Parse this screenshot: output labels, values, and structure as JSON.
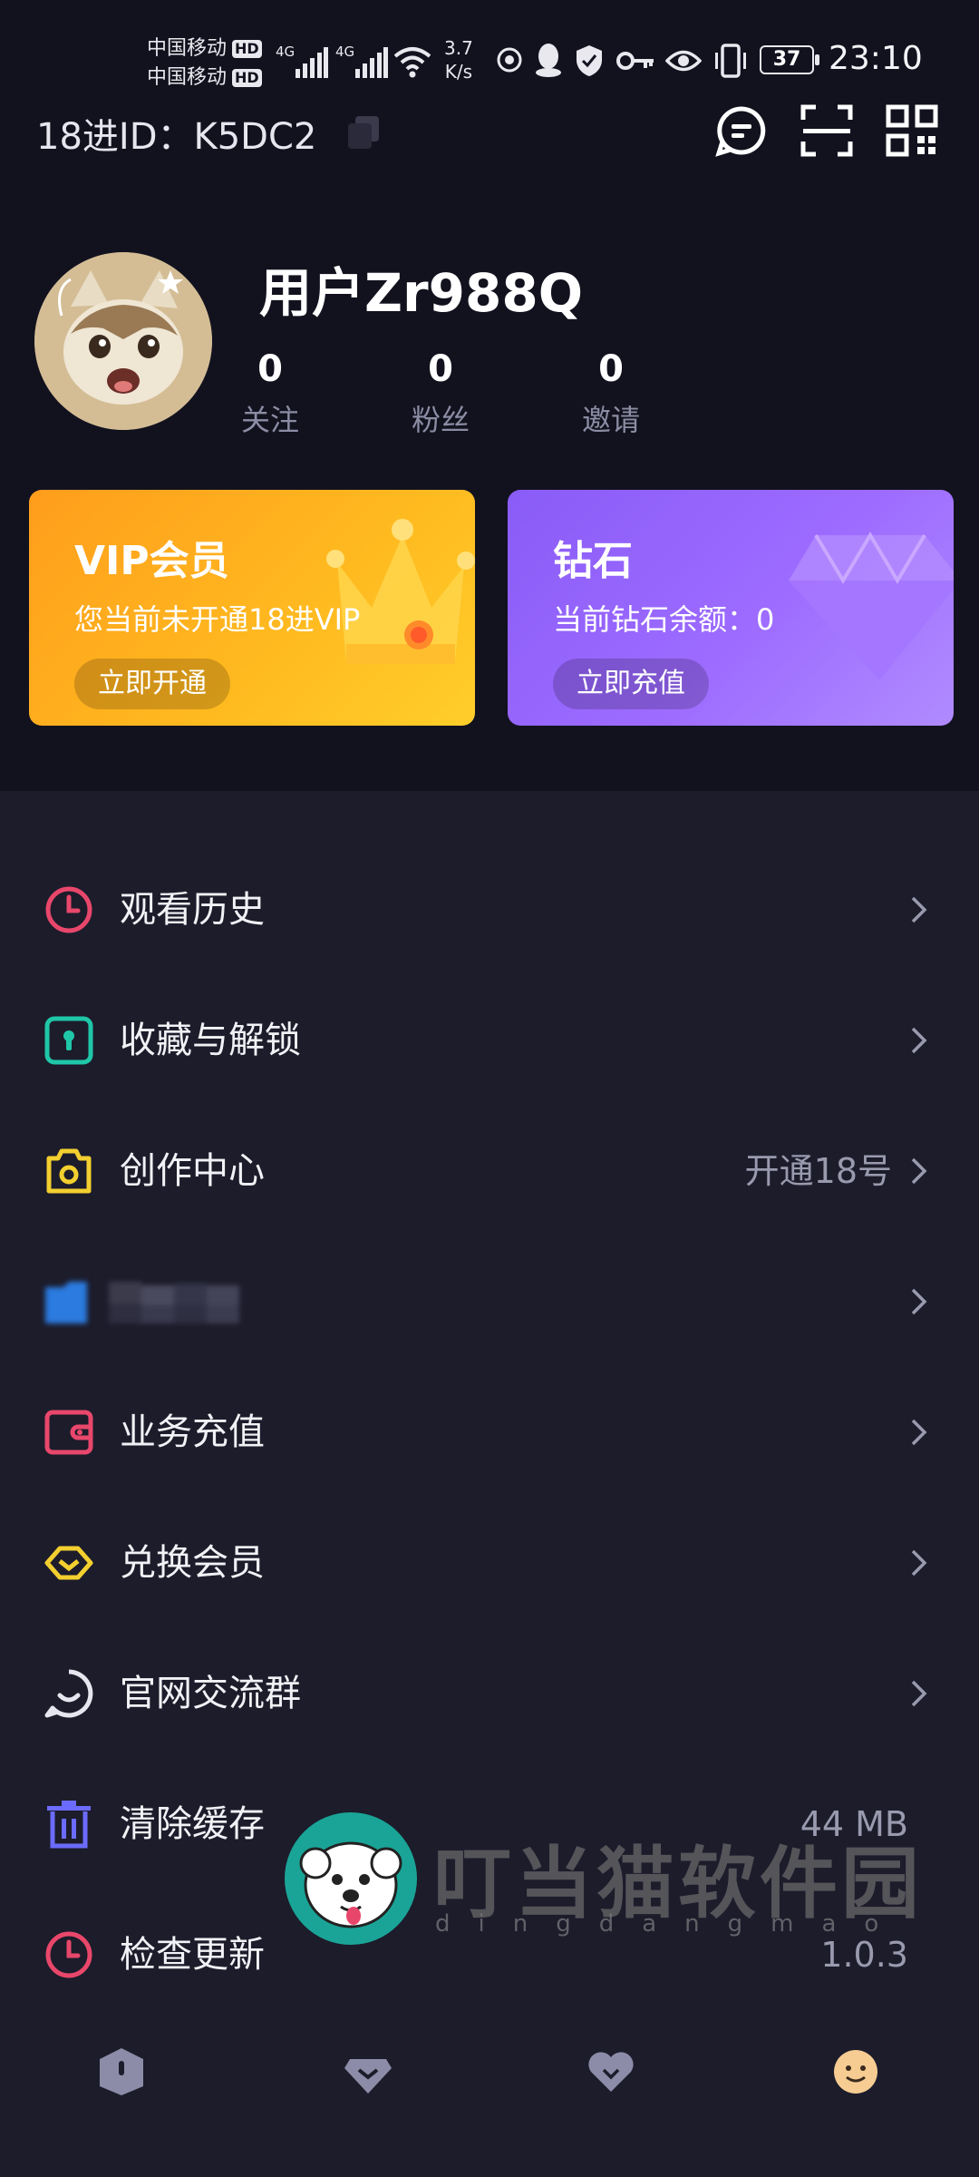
{
  "status_bar": {
    "carrier_1": "中国移动",
    "carrier_2": "中国移动",
    "hd_1": "HD",
    "hd_2": "HD",
    "sig_1": "4G",
    "sig_2": "4G",
    "net_speed_value": "3.7",
    "net_speed_unit": "K/s",
    "battery": "37",
    "time": "23:10",
    "icons": [
      "signal-icon",
      "wifi-icon",
      "qq-icon",
      "shield-icon",
      "key-icon",
      "eye-icon",
      "vibrate-icon",
      "battery-icon"
    ]
  },
  "header": {
    "user_id_text": "18进ID：K5DC2",
    "actions": [
      "message-icon",
      "scan-icon",
      "qrcode-icon"
    ]
  },
  "profile": {
    "username": "用户Zr988Q",
    "stats": [
      {
        "value": "0",
        "label": "关注"
      },
      {
        "value": "0",
        "label": "粉丝"
      },
      {
        "value": "0",
        "label": "邀请"
      }
    ]
  },
  "cards": {
    "vip": {
      "title": "VIP会员",
      "subtitle": "您当前未开通18进VIP",
      "button": "立即开通"
    },
    "diamond": {
      "title": "钻石",
      "subtitle": "当前钻石余额：0",
      "button": "立即充值"
    }
  },
  "menu": [
    {
      "label": "观看历史",
      "value": "",
      "icon": "history-icon",
      "color": "#e8476b"
    },
    {
      "label": "收藏与解锁",
      "value": "",
      "icon": "lock-icon",
      "color": "#1fc7a8"
    },
    {
      "label": "创作中心",
      "value": "开通18号",
      "icon": "camera-icon",
      "color": "#f3cf2f"
    },
    {
      "label": "",
      "value": "",
      "icon": "folder-icon",
      "color": "#2b7be0"
    },
    {
      "label": "业务充值",
      "value": "",
      "icon": "wallet-icon",
      "color": "#e8476b"
    },
    {
      "label": "兑换会员",
      "value": "",
      "icon": "ticket-icon",
      "color": "#f3cf2f"
    },
    {
      "label": "官网交流群",
      "value": "",
      "icon": "chat-icon",
      "color": "#e6e6ee"
    },
    {
      "label": "清除缓存",
      "value": "44 MB",
      "icon": "trash-icon",
      "color": "#6b6cff"
    },
    {
      "label": "检查更新",
      "value": "1.0.3",
      "icon": "update-icon",
      "color": "#e8476b"
    }
  ],
  "watermark": {
    "title": "叮当猫软件园",
    "subtitle": "dingdangmao"
  },
  "tabbar": [
    "tab-home-icon",
    "tab-diamond-icon",
    "tab-favorite-icon",
    "tab-profile-icon"
  ]
}
